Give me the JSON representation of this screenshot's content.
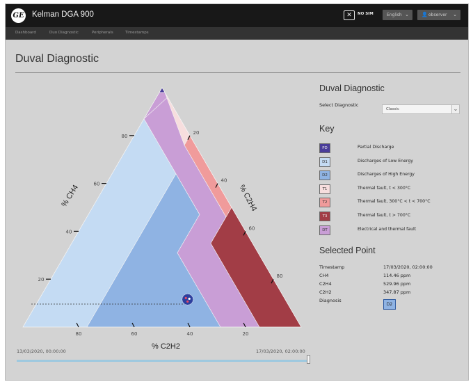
{
  "app": {
    "title": "Kelman DGA 900",
    "logo": "GE"
  },
  "topbar": {
    "sim_icon": "sim-card-crossed-icon",
    "sim_label": "NO SIM",
    "language": "English",
    "user": "observer"
  },
  "nav": {
    "items": [
      "Dashboard",
      "Duo Diagnostic",
      "Peripherals",
      "Timestamps"
    ]
  },
  "page": {
    "title": "Duval Diagnostic"
  },
  "triangle": {
    "axes": {
      "ch4": "% CH4",
      "c2h4": "% C2H4",
      "c2h2": "% C2H2"
    },
    "ticks_left": [
      "80",
      "60",
      "40",
      "20"
    ],
    "ticks_right": [
      "20",
      "40",
      "60",
      "80"
    ],
    "ticks_bottom": [
      "80",
      "60",
      "40",
      "20"
    ],
    "point": {
      "ch4": 11.446,
      "c2h4": 52.996,
      "c2h2": 34.787
    }
  },
  "panel": {
    "title": "Duval Diagnostic",
    "select_label": "Select Diagnostic",
    "select_value": "Classic",
    "key_title": "Key",
    "key": [
      {
        "code": "PD",
        "label": "Partial Discharge",
        "color": "#4a3d9a"
      },
      {
        "code": "D1",
        "label": "Discharges of Low Energy",
        "color": "#c4dbf3"
      },
      {
        "code": "D2",
        "label": "Discharges of High Energy",
        "color": "#8fb3e3"
      },
      {
        "code": "T1",
        "label": "Thermal fault, t < 300°C",
        "color": "#f7dede"
      },
      {
        "code": "T2",
        "label": "Thermal fault, 300°C < t < 700°C",
        "color": "#f09b9b"
      },
      {
        "code": "T3",
        "label": "Thermal fault, t > 700°C",
        "color": "#a23d46"
      },
      {
        "code": "DT",
        "label": "Electrical and thermal fault",
        "color": "#c99ed6"
      }
    ],
    "selected_title": "Selected Point",
    "selected": {
      "timestamp_label": "Timestamp",
      "timestamp": "17/03/2020, 02:00:00",
      "ch4_label": "CH4",
      "ch4": "114.46 ppm",
      "c2h4_label": "C2H4",
      "c2h4": "529.96 ppm",
      "c2h2_label": "C2H2",
      "c2h2": "347.87 ppm",
      "diagnosis_label": "Diagnosis",
      "diagnosis": "D2"
    }
  },
  "timeline": {
    "start": "13/03/2020, 00:00:00",
    "end": "17/03/2020, 02:00:00",
    "position": 1.0
  }
}
